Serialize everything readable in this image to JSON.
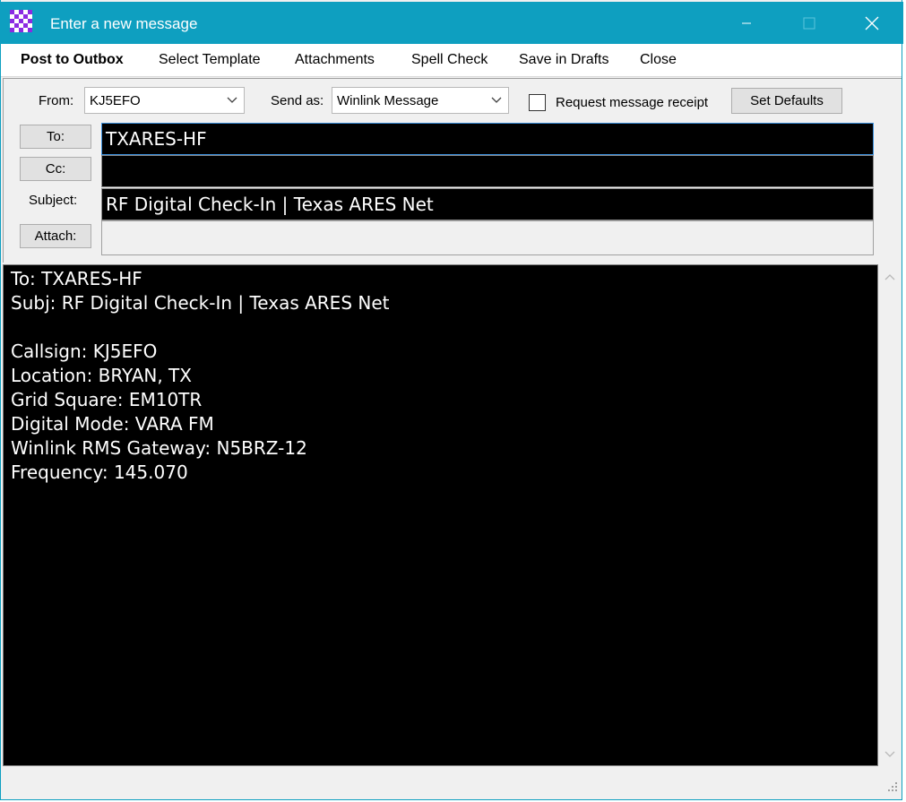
{
  "window": {
    "title": "Enter a new message",
    "accent_color": "#0e9fc0"
  },
  "menu": {
    "post_to_outbox": "Post to Outbox",
    "select_template": "Select Template",
    "attachments": "Attachments",
    "spell_check": "Spell Check",
    "save_in_drafts": "Save in Drafts",
    "close": "Close"
  },
  "form": {
    "from_label": "From:",
    "from_value": "KJ5EFO",
    "send_as_label": "Send as:",
    "send_as_value": "Winlink Message",
    "request_receipt_label": "Request message receipt",
    "request_receipt_checked": false,
    "set_defaults_label": "Set Defaults",
    "to_button": "To:",
    "to_value": "TXARES-HF",
    "cc_button": "Cc:",
    "cc_value": "",
    "subject_label": "Subject:",
    "subject_value": "RF Digital Check-In | Texas ARES Net",
    "attach_button": "Attach:",
    "attach_value": ""
  },
  "body": {
    "lines": [
      "To: TXARES-HF",
      "Subj: RF Digital Check-In | Texas ARES Net",
      "",
      "Callsign: KJ5EFO",
      "Location: BRYAN, TX",
      "Grid Square: EM10TR",
      "Digital Mode: VARA FM",
      "Winlink RMS Gateway: N5BRZ-12",
      "Frequency: 145.070"
    ]
  },
  "icons": {
    "app": "checkerboard-icon",
    "minimize": "minimize-icon",
    "maximize": "maximize-icon",
    "close": "close-icon",
    "dropdown": "chevron-down-icon",
    "scroll_up": "chevron-up-icon",
    "scroll_down": "chevron-down-icon",
    "resize_grip": "resize-grip-icon"
  }
}
